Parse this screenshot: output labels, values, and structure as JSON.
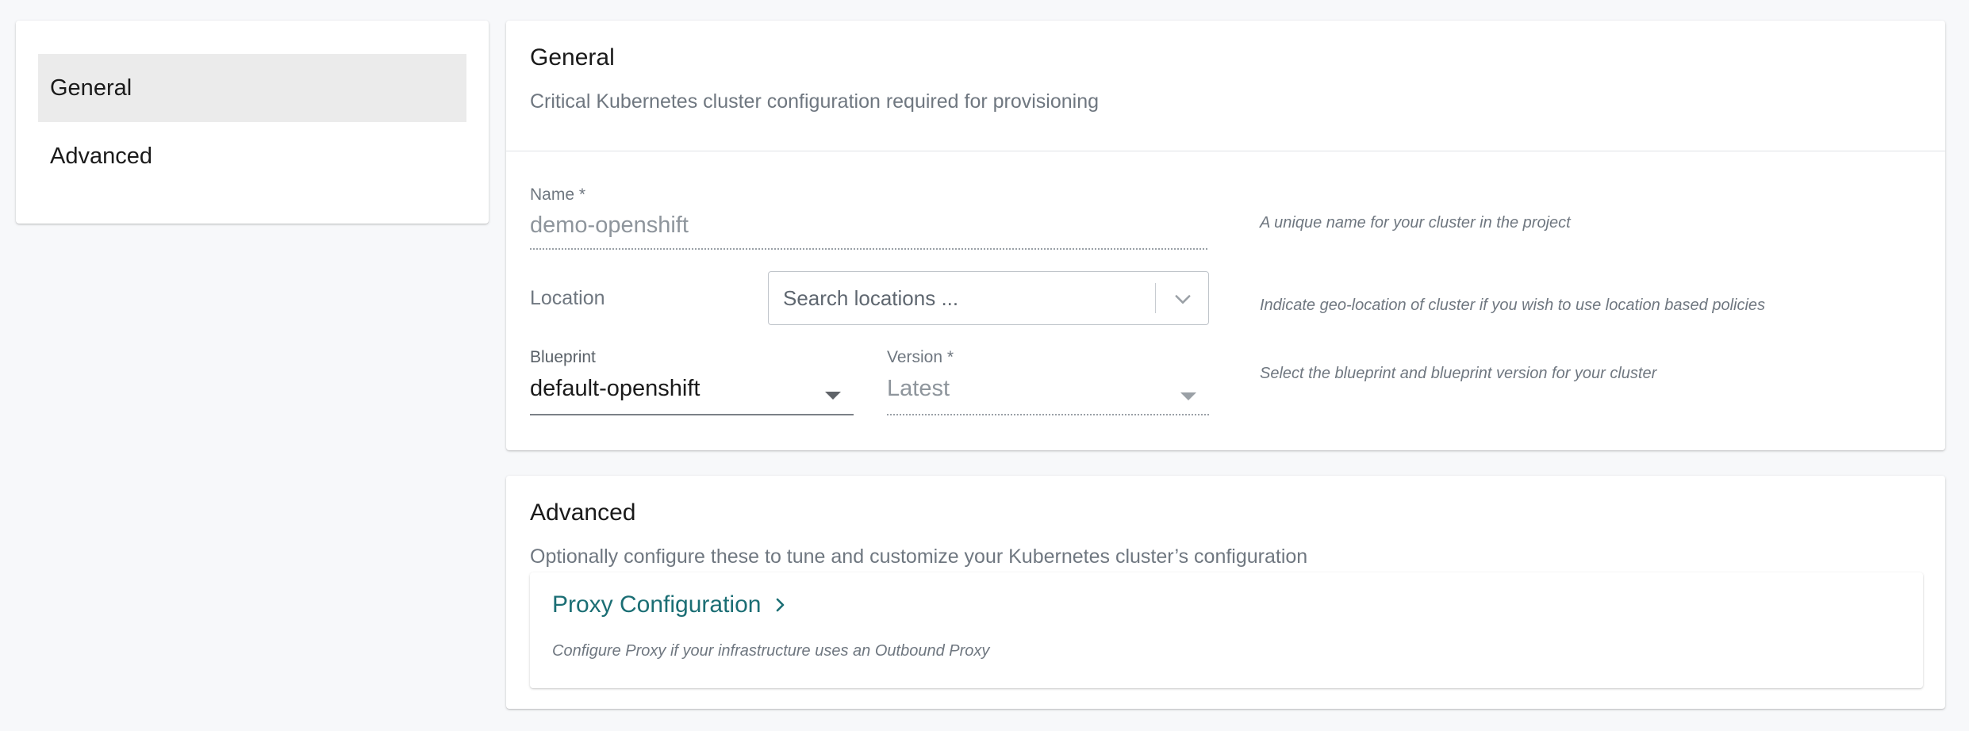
{
  "sidebar": {
    "items": [
      {
        "label": "General",
        "active": true
      },
      {
        "label": "Advanced",
        "active": false
      }
    ]
  },
  "general": {
    "title": "General",
    "subtitle": "Critical Kubernetes cluster configuration required for provisioning",
    "name": {
      "label": "Name *",
      "value": "demo-openshift",
      "hint": "A unique name for your cluster in the project"
    },
    "location": {
      "label": "Location",
      "placeholder": "Search locations ...",
      "hint": "Indicate geo-location of cluster if you wish to use location based policies"
    },
    "blueprint": {
      "label": "Blueprint",
      "value": "default-openshift"
    },
    "version": {
      "label": "Version *",
      "value": "Latest"
    },
    "blueprint_hint": "Select the blueprint and blueprint version for your cluster"
  },
  "advanced": {
    "title": "Advanced",
    "subtitle": "Optionally configure these to tune and customize your Kubernetes cluster’s configuration",
    "proxy": {
      "label": "Proxy Configuration",
      "description": "Configure Proxy if your infrastructure uses an Outbound Proxy"
    }
  },
  "colors": {
    "accent": "#1b6e74",
    "active_nav_bg": "#ebebeb",
    "muted_text": "#6f7780"
  },
  "icons": {
    "location_dropdown": "chevron-down-icon",
    "blueprint_dropdown": "caret-down-icon",
    "version_dropdown": "caret-down-icon",
    "proxy_link": "chevron-right-icon"
  }
}
